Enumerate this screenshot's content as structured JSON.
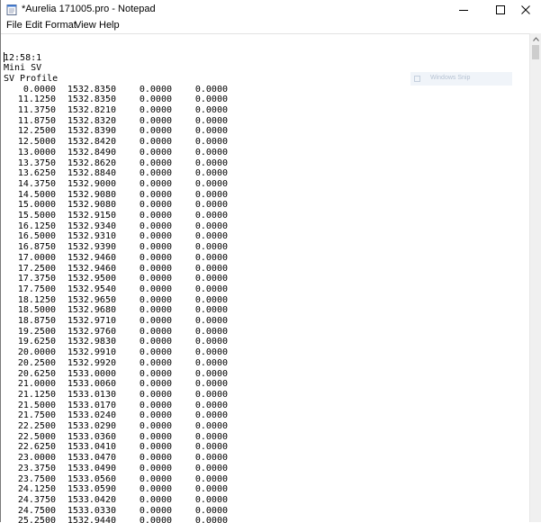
{
  "window": {
    "title": "*Aurelia 171005.pro - Notepad",
    "controls": {
      "minimize": "minimize-icon",
      "maximize": "maximize-icon",
      "close": "close-icon"
    }
  },
  "menu": {
    "file": "File",
    "edit": "Edit",
    "format": "Format",
    "view": "View",
    "help": "Help"
  },
  "document": {
    "header_lines": [
      "12:58:1",
      "Mini SV",
      "SV Profile"
    ],
    "rows": [
      [
        "0.0000",
        "1532.8350",
        "0.0000",
        "0.0000"
      ],
      [
        "11.1250",
        "1532.8350",
        "0.0000",
        "0.0000"
      ],
      [
        "11.3750",
        "1532.8210",
        "0.0000",
        "0.0000"
      ],
      [
        "11.8750",
        "1532.8320",
        "0.0000",
        "0.0000"
      ],
      [
        "12.2500",
        "1532.8390",
        "0.0000",
        "0.0000"
      ],
      [
        "12.5000",
        "1532.8420",
        "0.0000",
        "0.0000"
      ],
      [
        "13.0000",
        "1532.8490",
        "0.0000",
        "0.0000"
      ],
      [
        "13.3750",
        "1532.8620",
        "0.0000",
        "0.0000"
      ],
      [
        "13.6250",
        "1532.8840",
        "0.0000",
        "0.0000"
      ],
      [
        "14.3750",
        "1532.9000",
        "0.0000",
        "0.0000"
      ],
      [
        "14.5000",
        "1532.9080",
        "0.0000",
        "0.0000"
      ],
      [
        "15.0000",
        "1532.9080",
        "0.0000",
        "0.0000"
      ],
      [
        "15.5000",
        "1532.9150",
        "0.0000",
        "0.0000"
      ],
      [
        "16.1250",
        "1532.9340",
        "0.0000",
        "0.0000"
      ],
      [
        "16.5000",
        "1532.9310",
        "0.0000",
        "0.0000"
      ],
      [
        "16.8750",
        "1532.9390",
        "0.0000",
        "0.0000"
      ],
      [
        "17.0000",
        "1532.9460",
        "0.0000",
        "0.0000"
      ],
      [
        "17.2500",
        "1532.9460",
        "0.0000",
        "0.0000"
      ],
      [
        "17.3750",
        "1532.9500",
        "0.0000",
        "0.0000"
      ],
      [
        "17.7500",
        "1532.9540",
        "0.0000",
        "0.0000"
      ],
      [
        "18.1250",
        "1532.9650",
        "0.0000",
        "0.0000"
      ],
      [
        "18.5000",
        "1532.9680",
        "0.0000",
        "0.0000"
      ],
      [
        "18.8750",
        "1532.9710",
        "0.0000",
        "0.0000"
      ],
      [
        "19.2500",
        "1532.9760",
        "0.0000",
        "0.0000"
      ],
      [
        "19.6250",
        "1532.9830",
        "0.0000",
        "0.0000"
      ],
      [
        "20.0000",
        "1532.9910",
        "0.0000",
        "0.0000"
      ],
      [
        "20.2500",
        "1532.9920",
        "0.0000",
        "0.0000"
      ],
      [
        "20.6250",
        "1533.0000",
        "0.0000",
        "0.0000"
      ],
      [
        "21.0000",
        "1533.0060",
        "0.0000",
        "0.0000"
      ],
      [
        "21.1250",
        "1533.0130",
        "0.0000",
        "0.0000"
      ],
      [
        "21.5000",
        "1533.0170",
        "0.0000",
        "0.0000"
      ],
      [
        "21.7500",
        "1533.0240",
        "0.0000",
        "0.0000"
      ],
      [
        "22.2500",
        "1533.0290",
        "0.0000",
        "0.0000"
      ],
      [
        "22.5000",
        "1533.0360",
        "0.0000",
        "0.0000"
      ],
      [
        "22.6250",
        "1533.0410",
        "0.0000",
        "0.0000"
      ],
      [
        "23.0000",
        "1533.0470",
        "0.0000",
        "0.0000"
      ],
      [
        "23.3750",
        "1533.0490",
        "0.0000",
        "0.0000"
      ],
      [
        "23.7500",
        "1533.0560",
        "0.0000",
        "0.0000"
      ],
      [
        "24.1250",
        "1533.0590",
        "0.0000",
        "0.0000"
      ],
      [
        "24.3750",
        "1533.0420",
        "0.0000",
        "0.0000"
      ],
      [
        "24.7500",
        "1533.0330",
        "0.0000",
        "0.0000"
      ],
      [
        "25.2500",
        "1532.9440",
        "0.0000",
        "0.0000"
      ]
    ]
  },
  "overlay": {
    "ghost_label": "Windows Snip"
  },
  "colors": {
    "text": "#000000",
    "border": "#7a7a7a",
    "scroll_thumb": "#cdcdcd"
  }
}
